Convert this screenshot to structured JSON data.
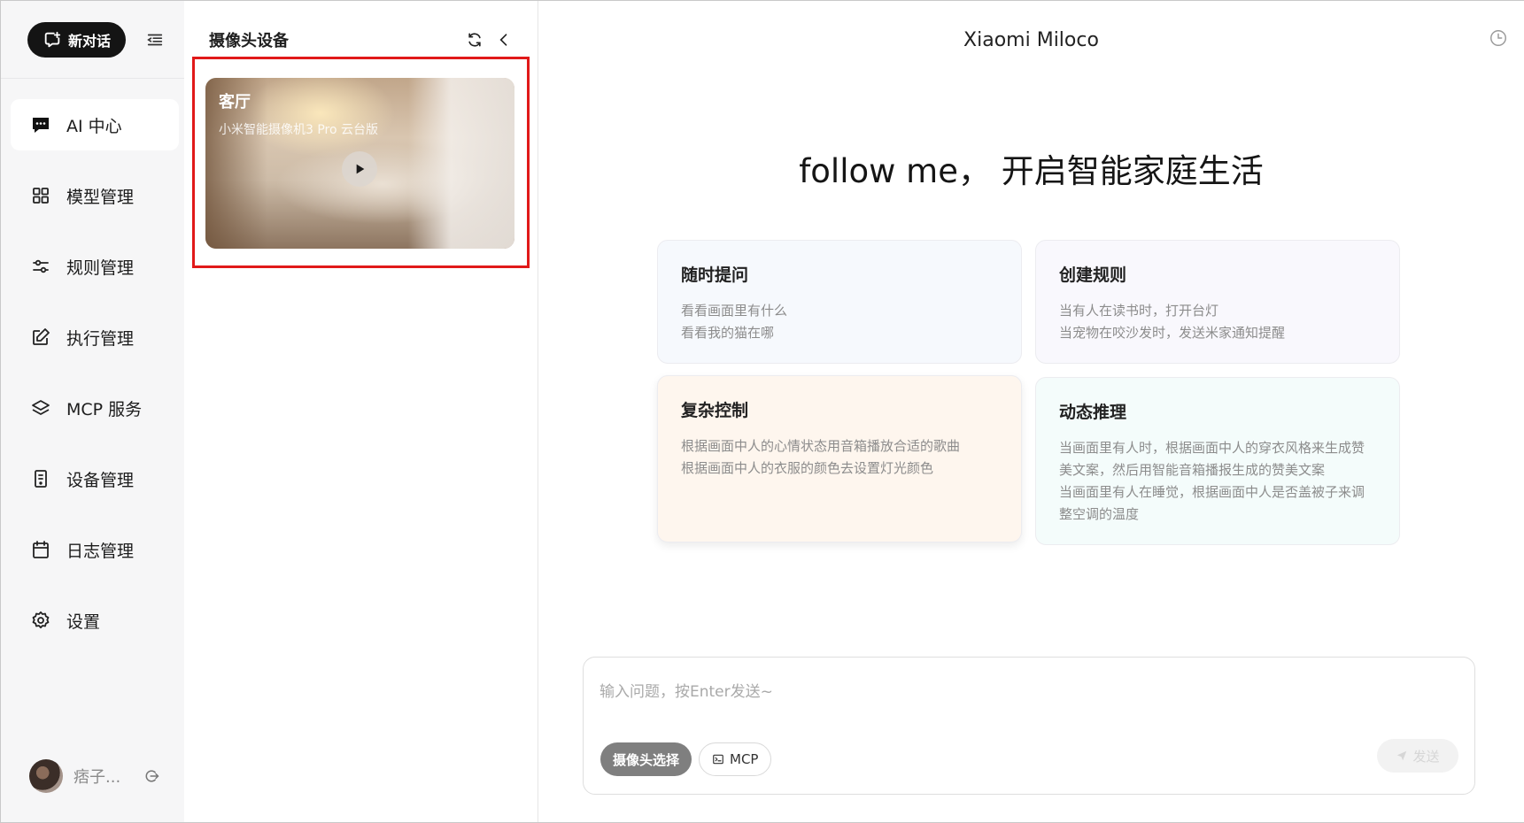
{
  "nav": {
    "new_chat_label": "新对话",
    "items": [
      {
        "label": "AI 中心",
        "icon": "chat-icon",
        "active": true
      },
      {
        "label": "模型管理",
        "icon": "grid-icon"
      },
      {
        "label": "规则管理",
        "icon": "sliders-icon"
      },
      {
        "label": "执行管理",
        "icon": "edit-icon"
      },
      {
        "label": "MCP 服务",
        "icon": "layers-icon"
      },
      {
        "label": "设备管理",
        "icon": "device-icon"
      },
      {
        "label": "日志管理",
        "icon": "calendar-icon"
      },
      {
        "label": "设置",
        "icon": "gear-icon"
      }
    ],
    "user_name": "痞子..."
  },
  "camera_panel": {
    "title": "摄像头设备",
    "card": {
      "room": "客厅",
      "model": "小米智能摄像机3 Pro 云台版"
    }
  },
  "main": {
    "brand": "Xiaomi Miloco",
    "hero": "follow me， 开启智能家庭生活",
    "cards": [
      {
        "title": "随时提问",
        "lines": [
          "看看画面里有什么",
          "看看我的猫在哪"
        ]
      },
      {
        "title": "创建规则",
        "lines": [
          "当有人在读书时，打开台灯",
          "当宠物在咬沙发时，发送米家通知提醒"
        ]
      },
      {
        "title": "复杂控制",
        "lines": [
          "根据画面中人的心情状态用音箱播放合适的歌曲",
          "根据画面中人的衣服的颜色去设置灯光颜色"
        ]
      },
      {
        "title": "动态推理",
        "lines": [
          "当画面里有人时，根据画面中人的穿衣风格来生成赞美文案，然后用智能音箱播报生成的赞美文案",
          "当画面里有人在睡觉，根据画面中人是否盖被子来调整空调的温度"
        ]
      }
    ],
    "input": {
      "placeholder": "输入问题，按Enter发送~",
      "camera_chip": "摄像头选择",
      "mcp_chip": "MCP",
      "send_label": "发送"
    }
  },
  "colors": {
    "highlight": "#e11919",
    "new_chat_bg": "#141414"
  }
}
